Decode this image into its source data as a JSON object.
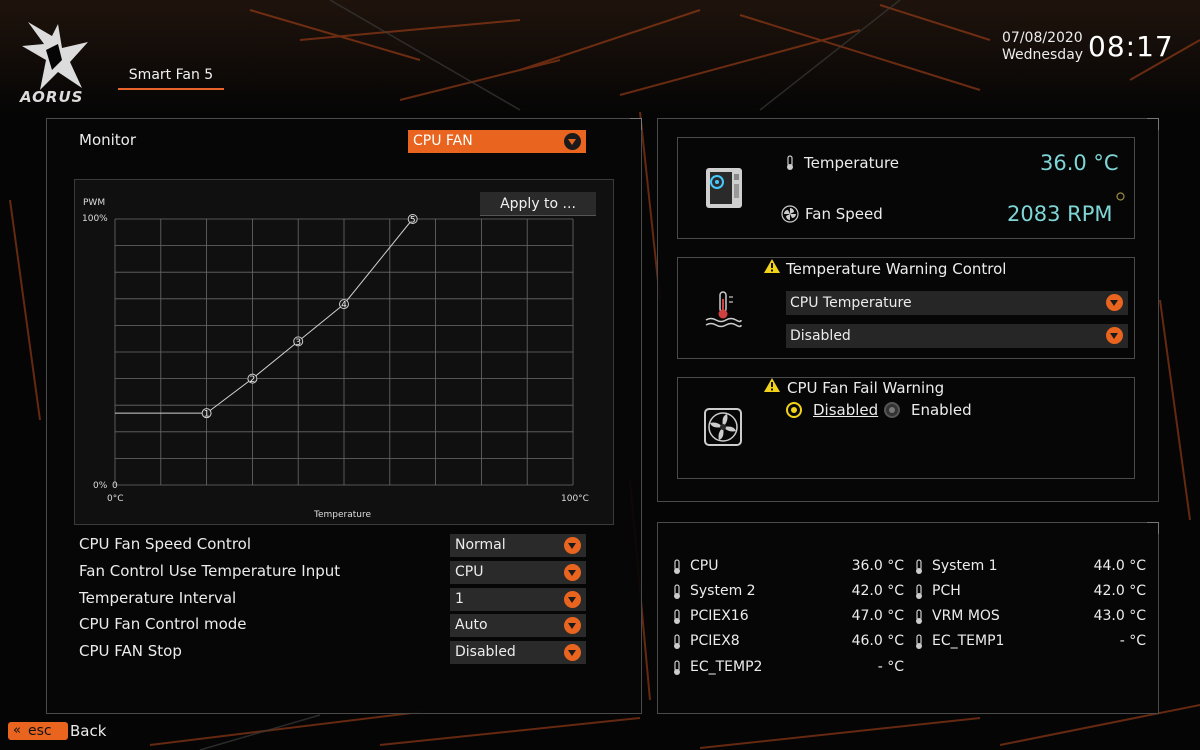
{
  "brand": {
    "logo_text": "AORUS"
  },
  "header": {
    "tab_label": "Smart Fan 5",
    "date": "07/08/2020",
    "weekday": "Wednesday",
    "time": "08:17"
  },
  "fan_panel": {
    "monitor_label": "Monitor",
    "monitor_selected": "CPU FAN",
    "apply_button": "Apply to ..."
  },
  "chart_data": {
    "type": "line",
    "ylabel": "PWM",
    "xlabel": "Temperature",
    "y_tick_top": "100%",
    "y_tick_bottom": "0%",
    "x_tick_left": "0°C",
    "x_tick_right": "100°C",
    "xlim": [
      0,
      100
    ],
    "ylim": [
      0,
      100
    ],
    "origin_label": "0",
    "points": [
      {
        "label": "1",
        "x": 20,
        "y": 27
      },
      {
        "label": "2",
        "x": 30,
        "y": 40
      },
      {
        "label": "3",
        "x": 40,
        "y": 54
      },
      {
        "label": "4",
        "x": 50,
        "y": 68
      },
      {
        "label": "5",
        "x": 65,
        "y": 100
      }
    ]
  },
  "settings": [
    {
      "label": "CPU Fan Speed Control",
      "value": "Normal"
    },
    {
      "label": "Fan Control Use Temperature Input",
      "value": "CPU"
    },
    {
      "label": "Temperature Interval",
      "value": "1"
    },
    {
      "label": "CPU Fan Control mode",
      "value": "Auto"
    },
    {
      "label": "CPU FAN Stop",
      "value": "Disabled"
    }
  ],
  "status": {
    "temp_label": "Temperature",
    "temp_value": "36.0 °C",
    "fan_label": "Fan Speed",
    "fan_value": "2083 RPM"
  },
  "temp_warning": {
    "title": "Temperature Warning Control",
    "source": "CPU Temperature",
    "value": "Disabled"
  },
  "fan_fail": {
    "title": "CPU Fan Fail Warning",
    "option_disabled": "Disabled",
    "option_enabled": "Enabled",
    "selected": "Disabled"
  },
  "sensors": [
    {
      "name": "CPU",
      "value": "36.0 °C"
    },
    {
      "name": "System 1",
      "value": "44.0 °C"
    },
    {
      "name": "System 2",
      "value": "42.0 °C"
    },
    {
      "name": "PCH",
      "value": "42.0 °C"
    },
    {
      "name": "PCIEX16",
      "value": "47.0 °C"
    },
    {
      "name": "VRM MOS",
      "value": "43.0 °C"
    },
    {
      "name": "PCIEX8",
      "value": "46.0 °C"
    },
    {
      "name": "EC_TEMP1",
      "value": "- °C"
    },
    {
      "name": "EC_TEMP2",
      "value": "- °C"
    }
  ],
  "footer": {
    "esc_label": "esc",
    "back_label": "Back"
  },
  "colors": {
    "accent": "#e8641f",
    "cyan": "#7fd6d6",
    "warn": "#f2d31a"
  }
}
